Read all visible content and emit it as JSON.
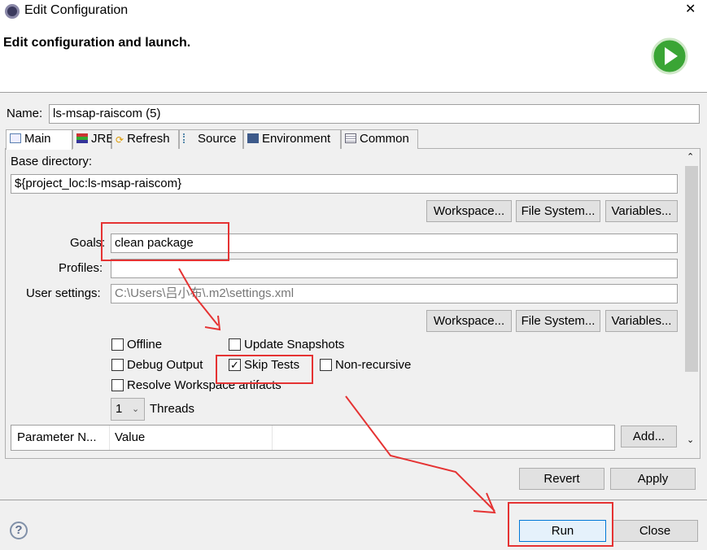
{
  "window": {
    "title": "Edit Configuration",
    "close": "✕"
  },
  "header": {
    "title": "Edit configuration and launch.",
    "icon": "run-launch-icon",
    "accent": "#3aa535"
  },
  "name": {
    "label": "Name:",
    "value": "ls-msap-raiscom (5)"
  },
  "tabs": [
    {
      "label": "Main",
      "icon": "main-tab-icon"
    },
    {
      "label": "JRE",
      "icon": "jre-icon"
    },
    {
      "label": "Refresh",
      "icon": "refresh-icon"
    },
    {
      "label": "Source",
      "icon": "source-icon"
    },
    {
      "label": "Environment",
      "icon": "environment-icon"
    },
    {
      "label": "Common",
      "icon": "common-icon"
    }
  ],
  "main": {
    "base_dir_label": "Base directory:",
    "base_dir_value": "${project_loc:ls-msap-raiscom}",
    "buttons": {
      "workspace": "Workspace...",
      "filesystem": "File System...",
      "variables": "Variables..."
    },
    "goals_label": "Goals:",
    "goals_value": "clean package",
    "profiles_label": "Profiles:",
    "profiles_value": "",
    "user_settings_label": "User settings:",
    "user_settings_value": "C:\\Users\\吕小布\\.m2\\settings.xml",
    "checkboxes": {
      "offline": {
        "label": "Offline",
        "checked": false
      },
      "update_snapshots": {
        "label": "Update Snapshots",
        "checked": false
      },
      "debug_output": {
        "label": "Debug Output",
        "checked": false
      },
      "skip_tests": {
        "label": "Skip Tests",
        "checked": true
      },
      "non_recursive": {
        "label": "Non-recursive",
        "checked": false
      },
      "resolve_workspace": {
        "label": "Resolve Workspace artifacts",
        "checked": false
      }
    },
    "threads_value": "1",
    "threads_label": "Threads",
    "table_headers": [
      "Parameter N...",
      "Value"
    ],
    "add_label": "Add..."
  },
  "footer": {
    "revert": "Revert",
    "apply": "Apply",
    "run": "Run",
    "close": "Close",
    "help": "?"
  },
  "annotation_color": "#e53333"
}
